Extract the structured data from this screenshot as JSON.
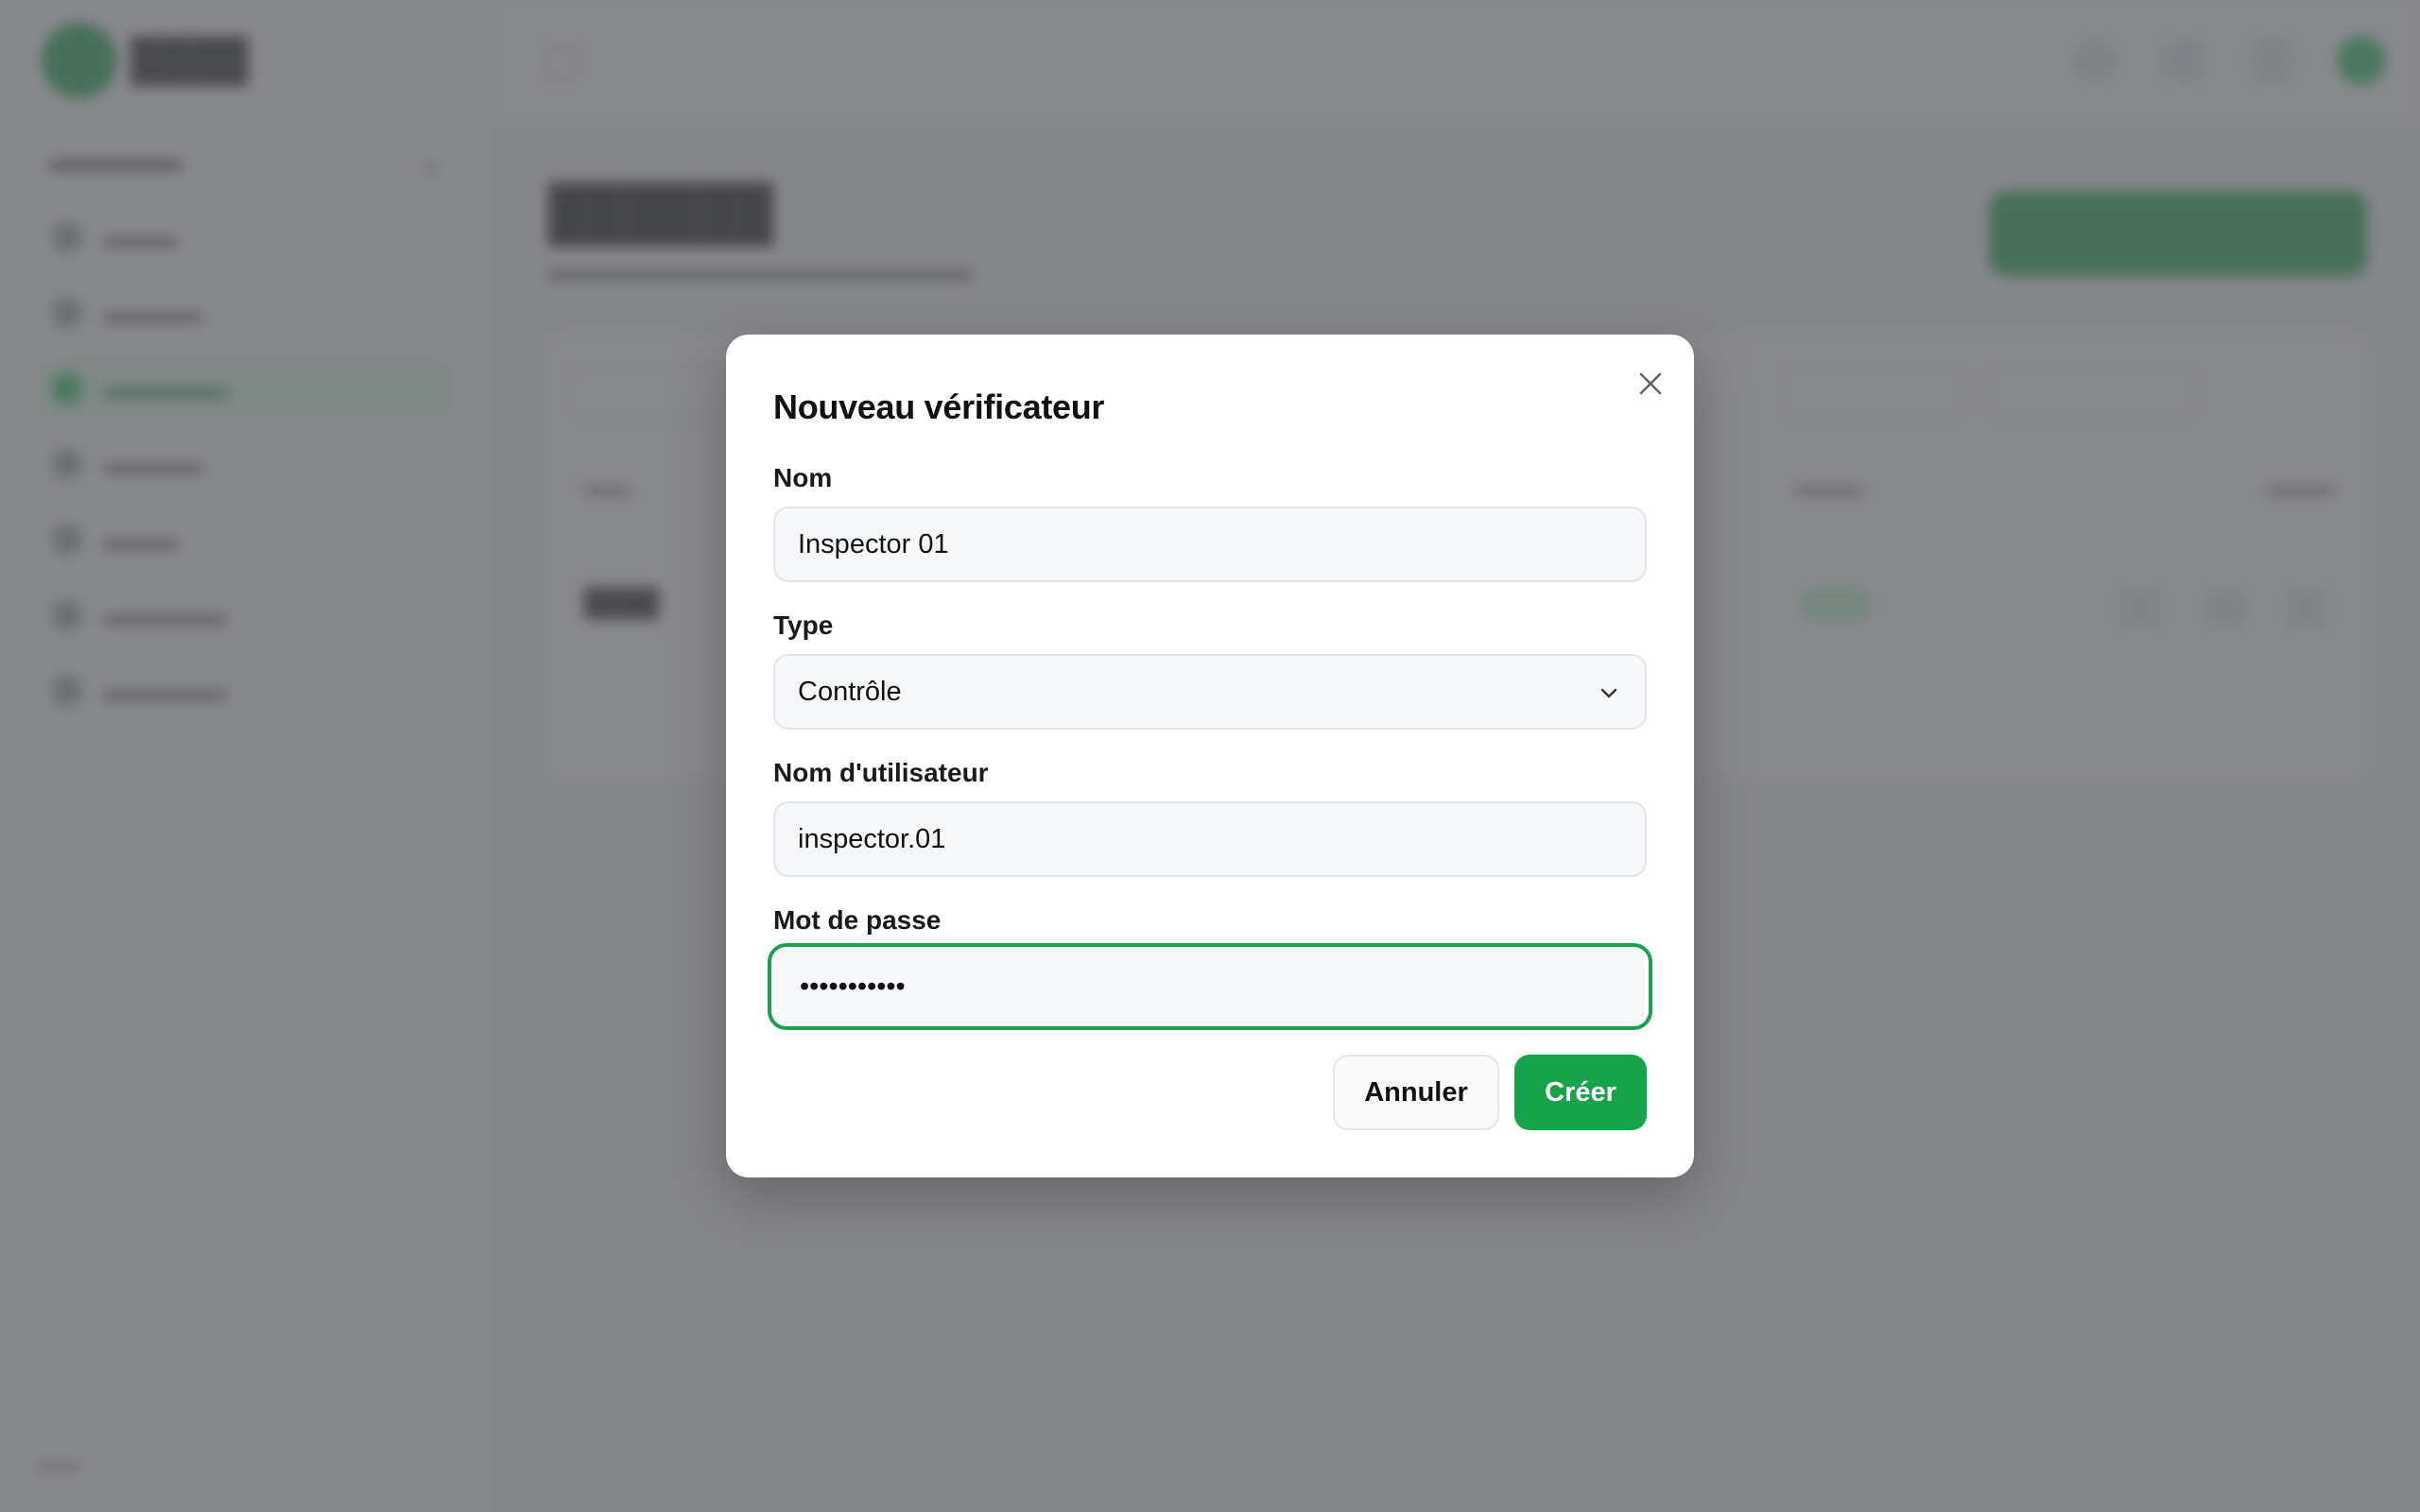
{
  "app": {
    "logo_icon": "app-logo",
    "sidebar_icons": [
      "dashboard-icon",
      "folder-icon",
      "checkmark-icon",
      "calendar-icon",
      "map-icon",
      "settings-icon",
      "reports-icon"
    ],
    "topbar_icons": [
      "sidebar-toggle-icon",
      "bell-icon",
      "search-icon",
      "help-icon",
      "avatar"
    ]
  },
  "modal": {
    "title": "Nouveau vérificateur",
    "close_icon": "close-icon",
    "fields": {
      "name": {
        "label": "Nom",
        "value": "Inspector 01"
      },
      "type": {
        "label": "Type",
        "value": "Contrôle",
        "icon": "chevron-down-icon"
      },
      "username": {
        "label": "Nom d'utilisateur",
        "value": "inspector.01"
      },
      "password": {
        "label": "Mot de passe",
        "value": "•••••••••••",
        "focused": true
      }
    },
    "buttons": {
      "cancel": "Annuler",
      "create": "Créer"
    }
  },
  "colors": {
    "accent": "#16a34a",
    "overlay": "#5a5c5f"
  }
}
